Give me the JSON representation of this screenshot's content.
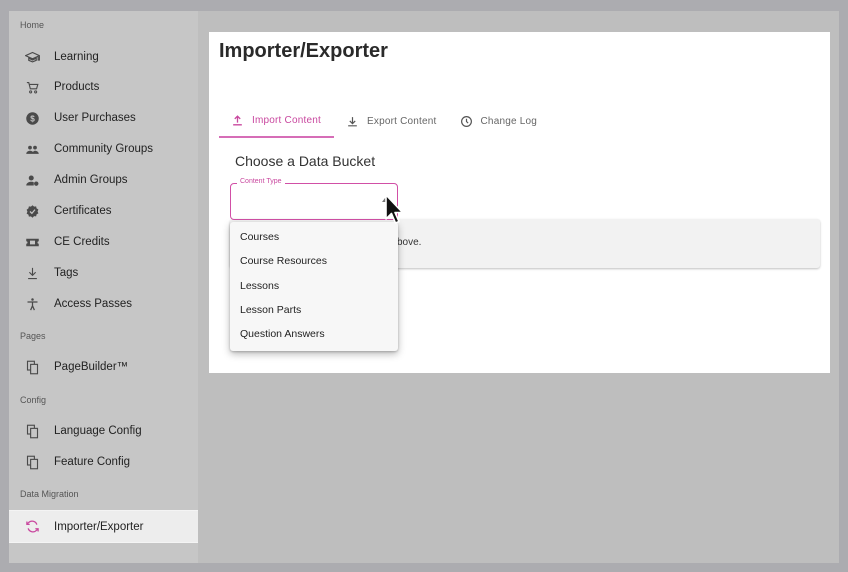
{
  "sidebar": {
    "sections": {
      "home": "Home",
      "pages": "Pages",
      "config": "Config",
      "data_migration": "Data Migration"
    },
    "items": [
      {
        "label": "Learning",
        "icon": "graduation-cap-icon"
      },
      {
        "label": "Products",
        "icon": "cart-icon"
      },
      {
        "label": "User Purchases",
        "icon": "dollar-icon"
      },
      {
        "label": "Community Groups",
        "icon": "group-icon"
      },
      {
        "label": "Admin Groups",
        "icon": "admin-group-icon"
      },
      {
        "label": "Certificates",
        "icon": "verified-icon"
      },
      {
        "label": "CE Credits",
        "icon": "ticket-icon"
      },
      {
        "label": "Tags",
        "icon": "tag-icon"
      },
      {
        "label": "Access Passes",
        "icon": "accessibility-icon"
      },
      {
        "label": "PageBuilder™",
        "icon": "copy-icon"
      },
      {
        "label": "Language Config",
        "icon": "copy-icon"
      },
      {
        "label": "Feature Config",
        "icon": "copy-icon"
      },
      {
        "label": "Importer/Exporter",
        "icon": "sync-icon",
        "active": true
      }
    ]
  },
  "main": {
    "title": "Importer/Exporter",
    "tabs": [
      {
        "label": "Import Content",
        "icon": "upload-icon",
        "active": true
      },
      {
        "label": "Export Content",
        "icon": "download-icon"
      },
      {
        "label": "Change Log",
        "icon": "clock-icon"
      }
    ],
    "bucket_title": "Choose a Data Bucket",
    "field": {
      "legend": "Content Type",
      "value": ""
    },
    "info_text": "bove.",
    "dropdown_options": [
      "Courses",
      "Course Resources",
      "Lessons",
      "Lesson Parts",
      "Question Answers"
    ]
  },
  "colors": {
    "accent": "#c9489f",
    "sidebar_bg": "#c6c6c6",
    "active_item_bg": "#ededed",
    "panel_bg": "#ffffff"
  }
}
